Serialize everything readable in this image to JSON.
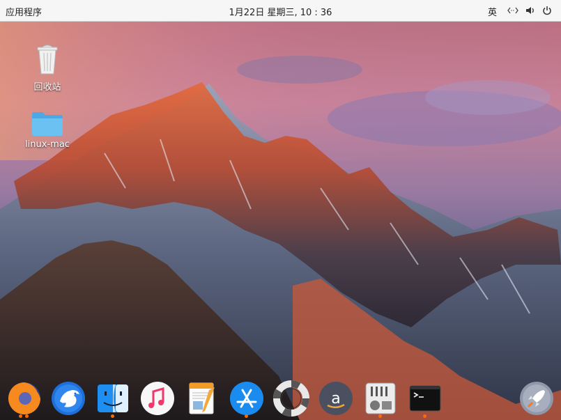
{
  "panel": {
    "apps_label": "应用程序",
    "clock": "1月22日 星期三, 10 : 36",
    "input_method": "英",
    "tray_icons": [
      "network-icon",
      "volume-icon",
      "power-icon"
    ]
  },
  "desktop": {
    "icons": [
      {
        "label": "回收站",
        "icon": "trash-icon"
      },
      {
        "label": "linux-mac",
        "icon": "folder-icon"
      }
    ]
  },
  "dock": {
    "items": [
      {
        "name": "firefox",
        "icon": "firefox-icon",
        "running": true
      },
      {
        "name": "eagle",
        "icon": "eagle-icon",
        "running": false
      },
      {
        "name": "finder",
        "icon": "finder-icon",
        "running": true
      },
      {
        "name": "music",
        "icon": "music-icon",
        "running": false
      },
      {
        "name": "pages",
        "icon": "pages-icon",
        "running": false
      },
      {
        "name": "app-store",
        "icon": "app-store-icon",
        "running": true
      },
      {
        "name": "help",
        "icon": "lifebuoy-icon",
        "running": false
      },
      {
        "name": "amazon",
        "icon": "amazon-icon",
        "running": false
      },
      {
        "name": "mixer",
        "icon": "mixer-icon",
        "running": true
      },
      {
        "name": "terminal",
        "icon": "terminal-icon",
        "running": true
      },
      {
        "name": "launchpad",
        "icon": "rocket-icon",
        "running": false
      }
    ]
  },
  "colors": {
    "panel_bg": "#f6f6f6",
    "running_dot": "#ff6a00",
    "folder": "#5db8f0"
  }
}
